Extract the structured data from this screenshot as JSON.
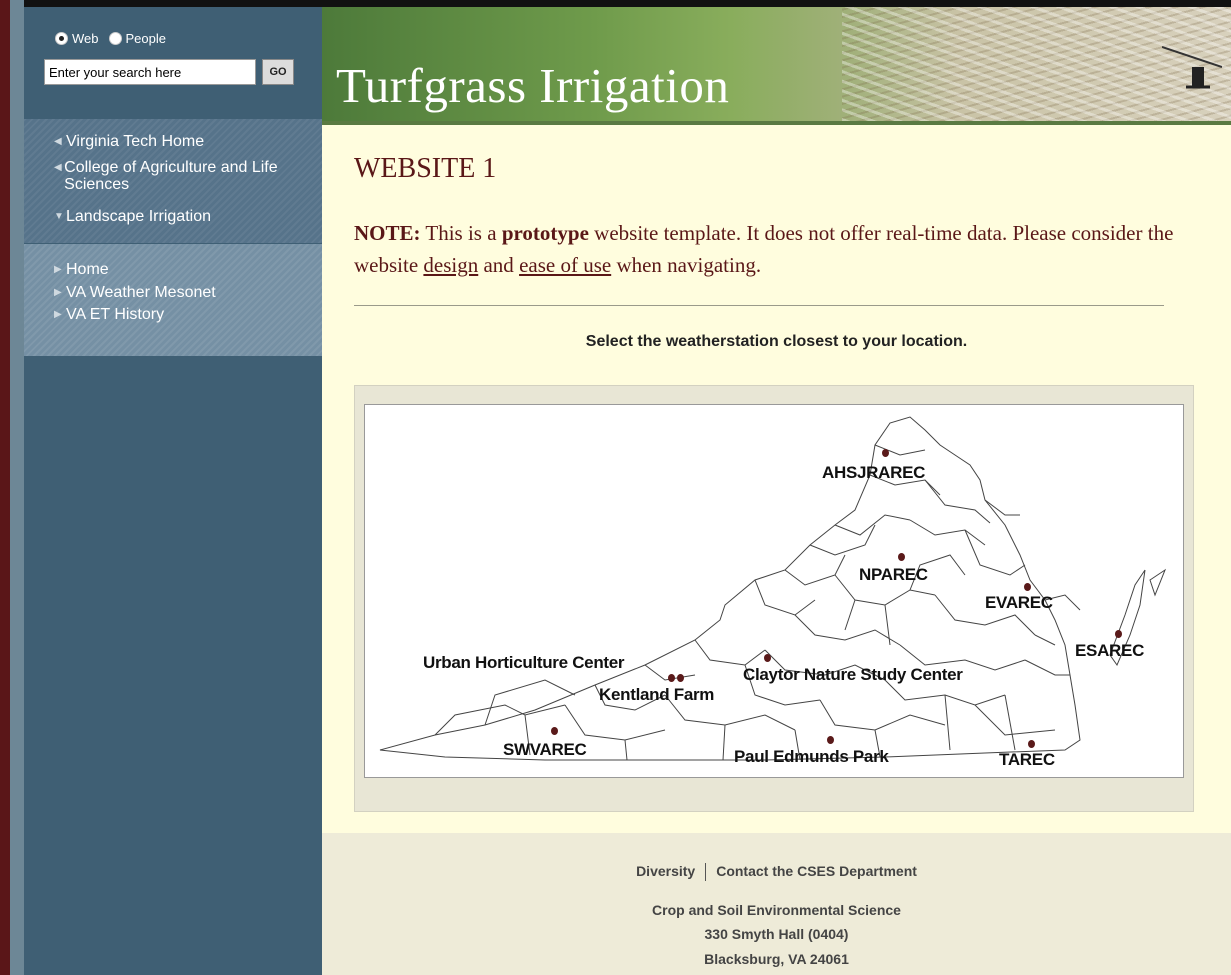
{
  "search": {
    "radio_web": "Web",
    "radio_people": "People",
    "placeholder": "Enter your search here",
    "go_label": "GO"
  },
  "sidebar": {
    "top_links": [
      {
        "label": "Virginia Tech Home"
      },
      {
        "label": "College of Agriculture and Life Sciences"
      },
      {
        "label": "Landscape Irrigation"
      }
    ],
    "sub_links": [
      {
        "label": "Home"
      },
      {
        "label": "VA Weather Mesonet"
      },
      {
        "label": "VA ET History"
      }
    ]
  },
  "header": {
    "site_title": "Turfgrass Irrigation"
  },
  "main": {
    "heading": "WEBSITE 1",
    "note_label": "NOTE:",
    "note_text_1": " This is a ",
    "note_bold": "prototype",
    "note_text_2": " website template. It does not offer real-time data. Please consider the website ",
    "note_link_design": "design",
    "note_text_3": " and ",
    "note_link_ease": "ease of use",
    "note_text_4": " when navigating.",
    "instruction": "Select the weatherstation closest to your location.",
    "stations": [
      "AHSJRAREC",
      "NPAREC",
      "EVAREC",
      "ESAREC",
      "Urban Horticulture Center",
      "Kentland Farm",
      "Claytor Nature Study Center",
      "SWVAREC",
      "Paul Edmunds Park",
      "TAREC"
    ]
  },
  "footer": {
    "link_diversity": "Diversity",
    "link_contact": "Contact the CSES Department",
    "dept": "Crop and Soil Environmental Science",
    "address1": "330 Smyth Hall (0404)",
    "address2": "Blacksburg, VA 24061"
  },
  "colors": {
    "sidebar": "#3f5f74",
    "main_bg": "#fffdde",
    "heading": "#5a1717",
    "station_dot": "#5a1a1a"
  }
}
